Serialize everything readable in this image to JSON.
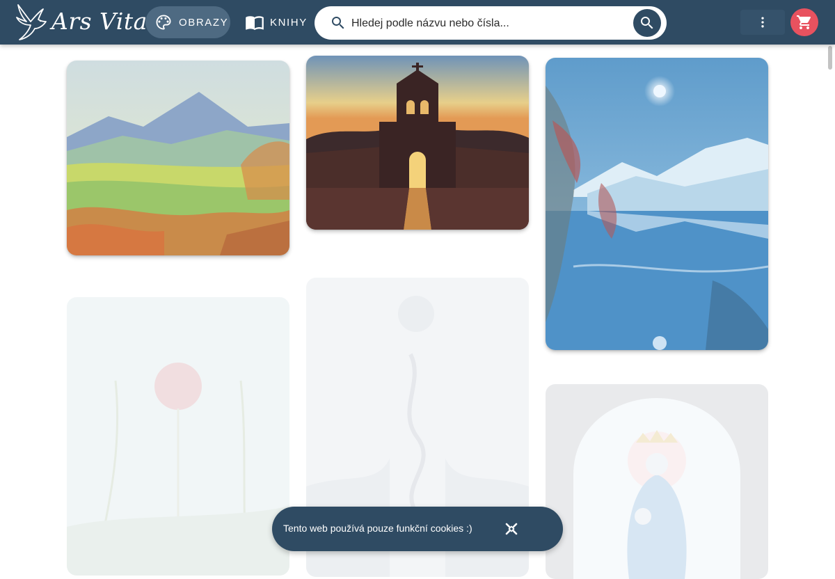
{
  "header": {
    "logo_text": "Ars Vita",
    "nav": [
      {
        "label": "OBRAZY",
        "icon": "palette-icon",
        "active": true
      },
      {
        "label": "KNIHY",
        "icon": "book-open-icon",
        "active": false
      }
    ],
    "search": {
      "placeholder": "Hledej podle názvu nebo čísla...",
      "value": ""
    },
    "menu_icon": "more-vert-icon",
    "cart_icon": "cart-icon"
  },
  "gallery": {
    "images": [
      {
        "subject": "mountain-landscape-painting",
        "faded": false
      },
      {
        "subject": "church-gate-sunset-painting",
        "faded": false
      },
      {
        "subject": "winter-lake-mountains-painting",
        "faded": false
      },
      {
        "subject": "flowers-sun-painting",
        "faded": true
      },
      {
        "subject": "religious-figure-painting",
        "faded": true
      },
      {
        "subject": "madonna-with-child-painting",
        "faded": true
      }
    ]
  },
  "cookie_banner": {
    "text": "Tento web používá pouze funkční cookies :)",
    "close_icon": "close-icon"
  },
  "colors": {
    "header_bg": "#2f4b63",
    "active_nav_bg": "#4e6a82",
    "cart_accent": "#e8525f"
  }
}
